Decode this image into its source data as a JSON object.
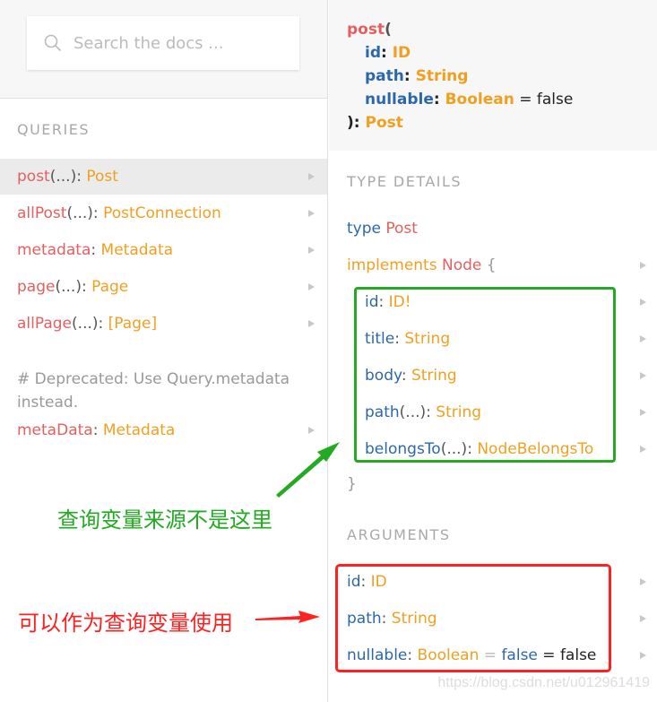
{
  "search": {
    "placeholder": "Search the docs ..."
  },
  "left": {
    "queries_title": "QUERIES",
    "items": [
      {
        "name": "post",
        "args": "(...)",
        "sep": ": ",
        "type": "Post",
        "active": true
      },
      {
        "name": "allPost",
        "args": "(...)",
        "sep": ": ",
        "type": "PostConnection"
      },
      {
        "name": "metadata",
        "args": "",
        "sep": ": ",
        "type": "Metadata"
      },
      {
        "name": "page",
        "args": "(...)",
        "sep": ": ",
        "type": "Page"
      },
      {
        "name": "allPage",
        "args": "(...)",
        "sep": ": ",
        "type": "[Page]"
      }
    ],
    "deprecated_note": "# Deprecated: Use Query.metadata instead.",
    "deprecated_item": {
      "name": "metaData",
      "sep": ": ",
      "type": "Metadata"
    }
  },
  "signature": {
    "name": "post",
    "open": "(",
    "args": [
      {
        "name": "id",
        "sep": ": ",
        "type": "ID",
        "default": ""
      },
      {
        "name": "path",
        "sep": ": ",
        "type": "String",
        "default": ""
      },
      {
        "name": "nullable",
        "sep": ": ",
        "type": "Boolean",
        "default": " = false"
      }
    ],
    "close": "): ",
    "return_type": "Post"
  },
  "type_details": {
    "title": "TYPE DETAILS",
    "type_kw": "type ",
    "type_name": "Post",
    "implements_kw": "implements ",
    "interface": "Node",
    "open_brace": " {",
    "close_brace": "}",
    "fields": [
      {
        "name": "id",
        "args": "",
        "sep": ": ",
        "type": "ID!"
      },
      {
        "name": "title",
        "args": "",
        "sep": ": ",
        "type": "String"
      },
      {
        "name": "body",
        "args": "",
        "sep": ": ",
        "type": "String"
      },
      {
        "name": "path",
        "args": "(...)",
        "sep": ": ",
        "type": "String"
      },
      {
        "name": "belongsTo",
        "args": "(...)",
        "sep": ": ",
        "type": "NodeBelongsTo"
      }
    ]
  },
  "arguments": {
    "title": "ARGUMENTS",
    "items": [
      {
        "name": "id",
        "sep": ": ",
        "type": "ID"
      },
      {
        "name": "path",
        "sep": ": ",
        "type": "String"
      },
      {
        "name": "nullable",
        "sep": ": ",
        "type": "Boolean",
        "eq": " = ",
        "default_value": "false",
        "extra": " = false"
      }
    ]
  },
  "annotations": {
    "green_note": "查询变量来源不是这里",
    "red_note": "可以作为查询变量使用",
    "green_color": "#22aa22",
    "red_color": "#ff2020"
  },
  "watermark": "https://blog.csdn.net/u012961419"
}
